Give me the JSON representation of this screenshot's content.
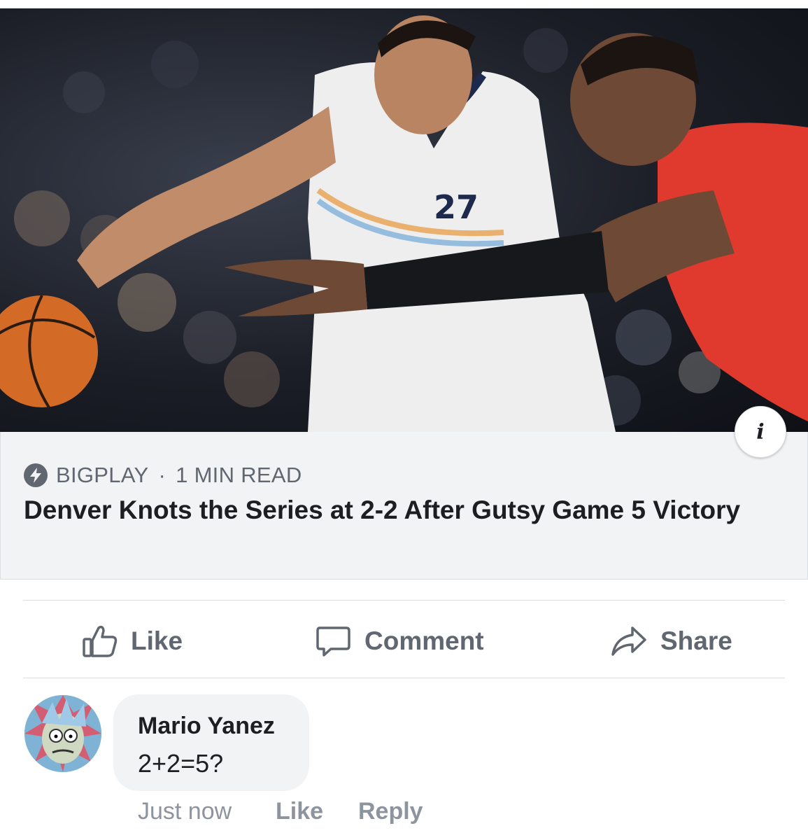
{
  "article": {
    "source": "BIGPLAY",
    "separator": "·",
    "read_time": "1 MIN READ",
    "headline": "Denver Knots the Series at 2-2 After Gutsy Game 5 Victory",
    "image_icon": "info-icon"
  },
  "actions": {
    "like": "Like",
    "comment": "Comment",
    "share": "Share"
  },
  "comment": {
    "author": "Mario Yanez",
    "text": "2+2=5?",
    "time": "Just now",
    "like": "Like",
    "reply": "Reply"
  },
  "colors": {
    "link_box_bg": "#f2f3f5",
    "action_text": "#606770",
    "meta_text": "#8d949e",
    "jersey_red": "#e03a2f"
  }
}
